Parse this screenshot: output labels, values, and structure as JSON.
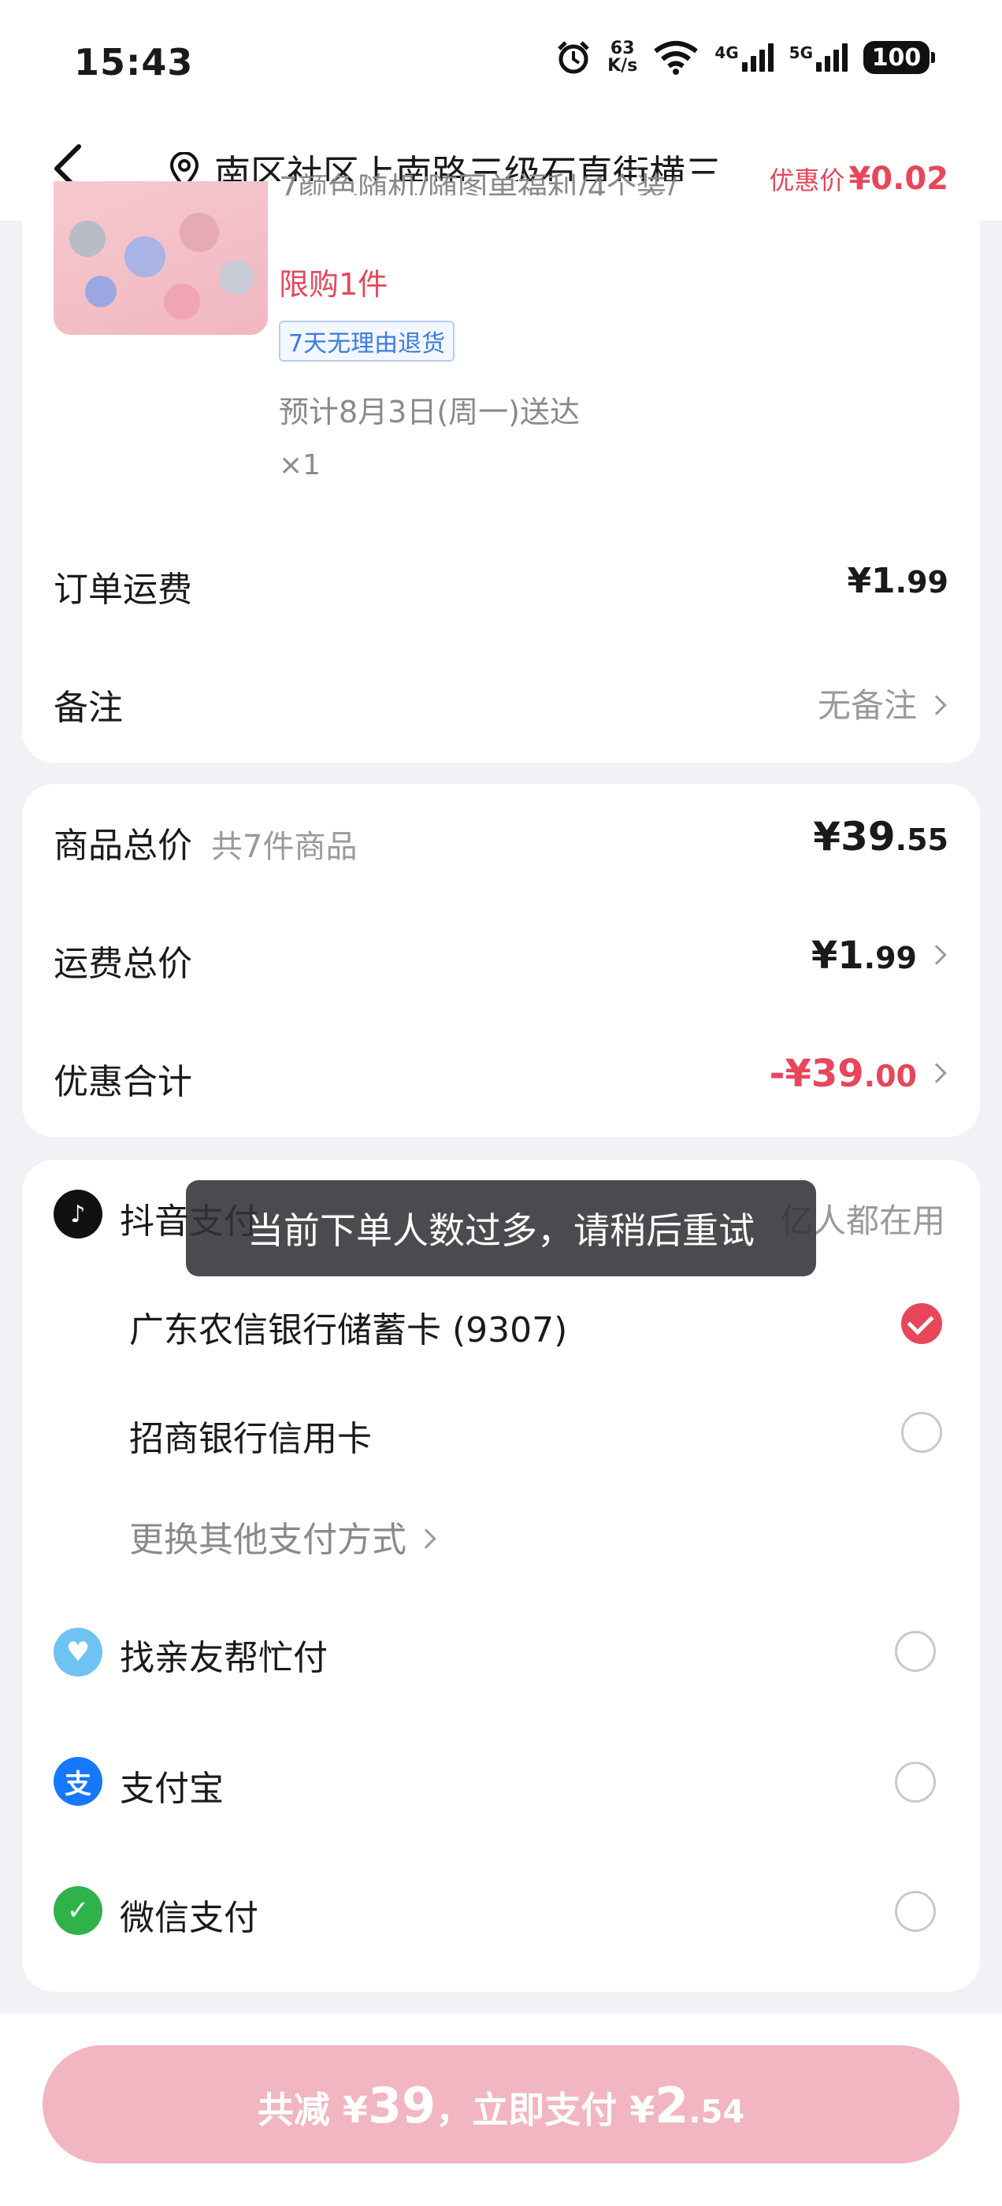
{
  "status": {
    "time": "15:43",
    "speed_top": "63",
    "speed_bottom": "K/s",
    "net1": "4G",
    "net2": "5G",
    "battery": "100"
  },
  "header": {
    "address": "南区社区上南路三级石直街横三..."
  },
  "product": {
    "spec_text": "7颜色随机/随图单福利/4个装/",
    "promo_label": "优惠价",
    "promo_price": "¥0.02",
    "limit": "限购1件",
    "return_tag": "7天无理由退货",
    "delivery": "预计8月3日(周一)送达",
    "quantity": "×1"
  },
  "order": {
    "shipping_label": "订单运费",
    "shipping_value_int": "¥1",
    "shipping_value_dec": ".99",
    "note_label": "备注",
    "note_value": "无备注"
  },
  "summary": {
    "total_label": "商品总价",
    "total_count": "共7件商品",
    "total_int": "¥39",
    "total_dec": ".55",
    "freight_label": "运费总价",
    "freight_int": "¥1",
    "freight_dec": ".99",
    "discount_label": "优惠合计",
    "discount_int": "-¥39",
    "discount_dec": ".00"
  },
  "payment": {
    "douyin_label": "抖音支付",
    "douyin_slogan": "亿人都在用",
    "cards": [
      {
        "label": "广东农信银行储蓄卡 (9307)",
        "selected": true
      },
      {
        "label": "招商银行信用卡",
        "selected": false
      }
    ],
    "other_methods": "更换其他支付方式",
    "friend_pay": "找亲友帮忙付",
    "alipay": "支付宝",
    "wechat": "微信支付"
  },
  "toast": "当前下单人数过多，请稍后重试",
  "bottom": {
    "prefix": "共减 ¥",
    "reduce": "39",
    "mid": "，立即支付 ¥",
    "pay_int": "2",
    "pay_dec": ".54"
  },
  "colors": {
    "accent_red": "#e8465a",
    "pay_button": "#f1b6c1",
    "tag_blue": "#3b7be0"
  }
}
